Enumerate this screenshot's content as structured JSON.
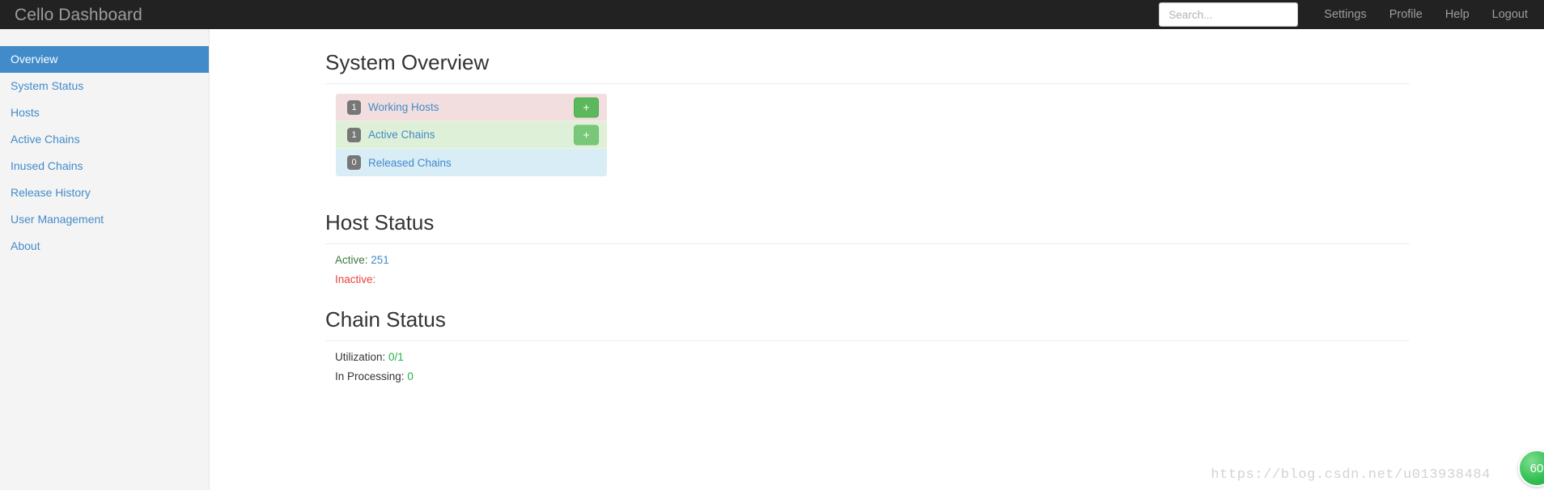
{
  "navbar": {
    "brand": "Cello Dashboard",
    "search": {
      "placeholder": "Search...",
      "value": ""
    },
    "links": [
      {
        "label": "Settings"
      },
      {
        "label": "Profile"
      },
      {
        "label": "Help"
      },
      {
        "label": "Logout"
      }
    ]
  },
  "sidebar": {
    "items": [
      {
        "label": "Overview",
        "active": true
      },
      {
        "label": "System Status",
        "active": false
      },
      {
        "label": "Hosts",
        "active": false
      },
      {
        "label": "Active Chains",
        "active": false
      },
      {
        "label": "Inused Chains",
        "active": false
      },
      {
        "label": "Release History",
        "active": false
      },
      {
        "label": "User Management",
        "active": false
      },
      {
        "label": "About",
        "active": false
      }
    ]
  },
  "main": {
    "system_overview": {
      "title": "System Overview",
      "items": [
        {
          "count": "1",
          "label": "Working Hosts",
          "variant": "danger",
          "add_label": "+",
          "has_add": true
        },
        {
          "count": "1",
          "label": "Active Chains",
          "variant": "success",
          "add_label": "+",
          "has_add": true
        },
        {
          "count": "0",
          "label": "Released Chains",
          "variant": "info",
          "add_label": "+",
          "has_add": false
        }
      ]
    },
    "host_status": {
      "title": "Host Status",
      "rows": [
        {
          "label": "Active:",
          "value": "251"
        },
        {
          "label": "Inactive:",
          "value": ""
        }
      ]
    },
    "chain_status": {
      "title": "Chain Status",
      "rows": [
        {
          "label": "Utilization:",
          "value": "0/1"
        },
        {
          "label": "In Processing:",
          "value": "0"
        }
      ]
    }
  },
  "watermark": {
    "url": "https://blog.csdn.net/u013938484",
    "badge": "60"
  },
  "colors": {
    "navbar_bg": "#222222",
    "sidebar_bg": "#f4f4f4",
    "accent_blue": "#428bca",
    "success_green": "#5cb85c",
    "danger_bg": "#f2dede",
    "success_bg": "#dff0d8",
    "info_bg": "#d9edf7",
    "badge_gray": "#777777"
  }
}
